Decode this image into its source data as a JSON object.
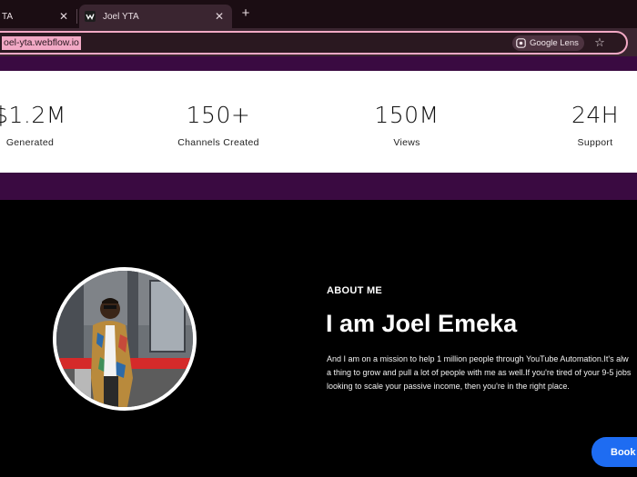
{
  "browser": {
    "tabs": [
      {
        "title": "TA",
        "active": false
      },
      {
        "title": "Joel YTA",
        "active": true
      }
    ],
    "url": "oel-yta.webflow.io",
    "lens_label": "Google Lens"
  },
  "stats": [
    {
      "value": "$1.2M",
      "label": "Generated"
    },
    {
      "value": "150+",
      "label": "Channels Created"
    },
    {
      "value": "150M",
      "label": "Views"
    },
    {
      "value": "24H",
      "label": "Support"
    }
  ],
  "about": {
    "label": "ABOUT ME",
    "title": "I am Joel Emeka",
    "lines": [
      "And I am on a mission to help 1 million people through YouTube Automation.It's alw",
      "a thing to grow and pull a lot of people with me as well.If you're tired of your 9-5 jobs",
      "looking to scale your passive income, then you're in the right place."
    ]
  },
  "cta": {
    "label": "Book"
  },
  "colors": {
    "tabbar": "#1b0d13",
    "toolbar": "#3a2530",
    "accent_pink": "#f2a9c5",
    "brand_purple": "#3a0a41",
    "cta_blue": "#1e6cf2"
  }
}
